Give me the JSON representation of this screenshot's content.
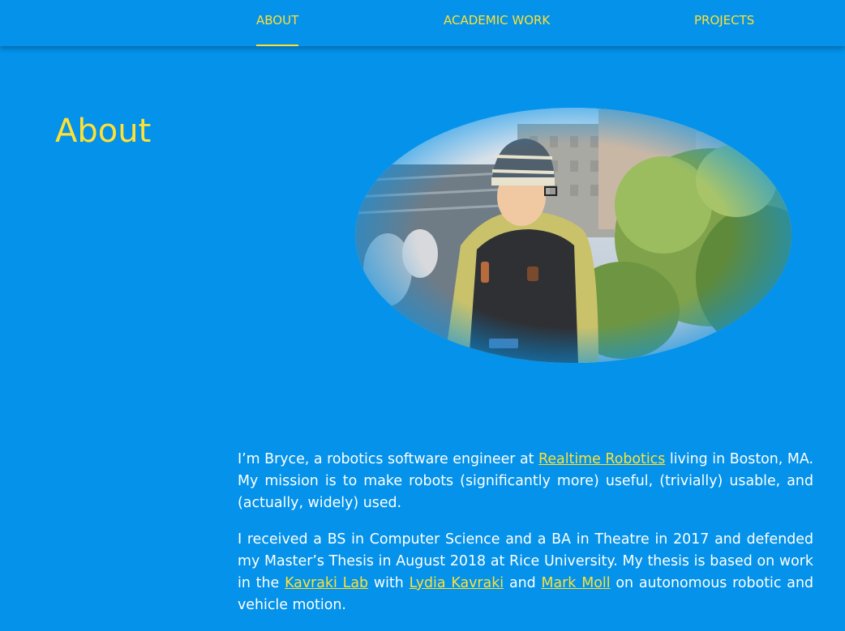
{
  "nav": {
    "items": [
      {
        "label": "ABOUT",
        "active": true
      },
      {
        "label": "ACADEMIC WORK",
        "active": false
      },
      {
        "label": "PROJECTS",
        "active": false
      }
    ]
  },
  "page": {
    "title": "About"
  },
  "photo": {
    "alt": "Bryce, seen from behind wearing a striped beanie and backpack, outdoors among trees"
  },
  "bio": {
    "p1_text1": "I’m Bryce, a robotics software engineer at ",
    "p1_link": "Realtime Robotics",
    "p1_text2": " living in Boston, MA. My mission is to make robots (significantly more) useful, (trivially) usable, and (actually, widely) used.",
    "p2_text1": "I received a BS in Computer Science and a BA in Theatre in 2017 and defended my Master’s Thesis in August 2018 at Rice University. My thesis is based on work in the ",
    "p2_link1": "Kavraki Lab",
    "p2_text2": " with ",
    "p2_link2": "Lydia Kavraki",
    "p2_text3": " and ",
    "p2_link3": "Mark Moll",
    "p2_text4": " on autonomous robotic and vehicle motion."
  },
  "colors": {
    "background": "#0492ea",
    "accent": "#ffe135",
    "text": "#ffffff"
  }
}
